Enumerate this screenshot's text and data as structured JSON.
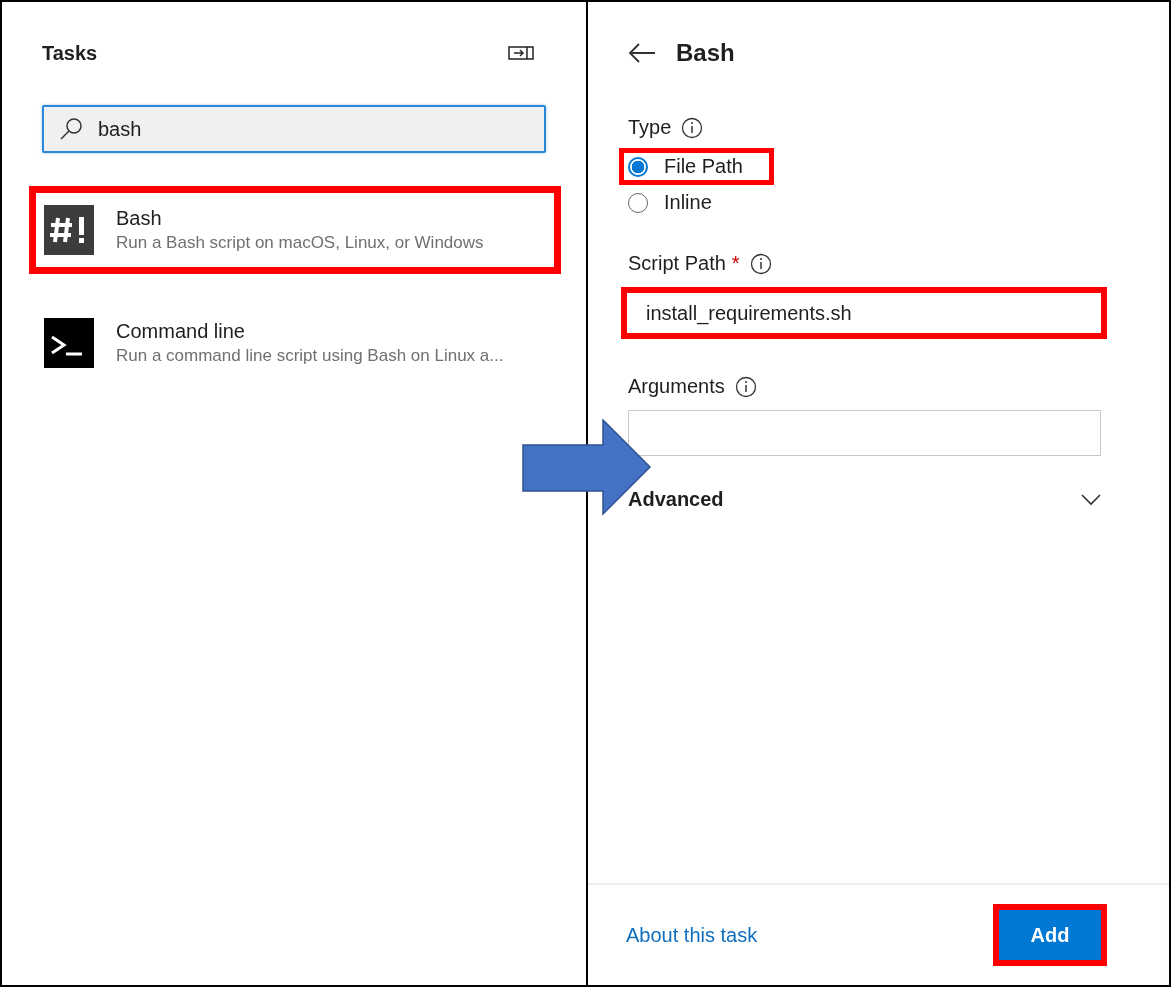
{
  "tasks_panel": {
    "title": "Tasks",
    "search": {
      "value": "bash"
    },
    "items": [
      {
        "kind": "bash",
        "title": "Bash",
        "description": "Run a Bash script on macOS, Linux, or Windows",
        "highlighted": true
      },
      {
        "kind": "terminal",
        "title": "Command line",
        "description": "Run a command line script using Bash on Linux a...",
        "highlighted": false
      }
    ]
  },
  "task_panel": {
    "title": "Bash",
    "type_field": {
      "label": "Type",
      "options": [
        {
          "label": "File Path",
          "selected": true,
          "highlighted": true
        },
        {
          "label": "Inline",
          "selected": false,
          "highlighted": false
        }
      ]
    },
    "script_path": {
      "label": "Script Path",
      "required_mark": "*",
      "value": "install_requirements.sh",
      "highlighted": true
    },
    "arguments": {
      "label": "Arguments"
    },
    "advanced": {
      "label": "Advanced",
      "expanded": false
    },
    "about_link": "About this task",
    "add_button": {
      "label": "Add",
      "highlighted": true
    }
  }
}
